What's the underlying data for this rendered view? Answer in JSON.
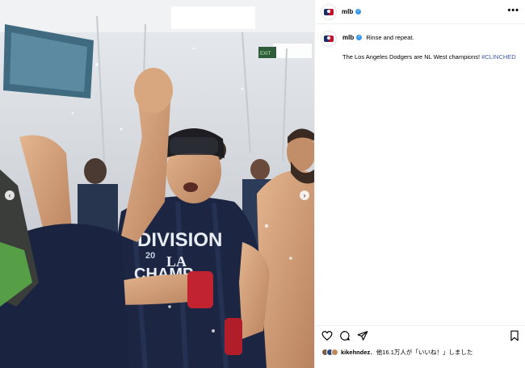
{
  "post": {
    "username": "mlb",
    "verified_mark": "✓",
    "more_glyph": "•••",
    "caption_lead": "Rinse and repeat.",
    "caption_body": "The Los Angeles Dodgers are NL West champions! ",
    "hashtag": "#CLINCHED"
  },
  "media": {
    "prev_glyph": "‹",
    "next_glyph": "›",
    "jersey_line1": "DIVISION",
    "jersey_line2": "20",
    "jersey_logo": "LA",
    "jersey_line3": "CHAMP",
    "exit_sign": "EXIT"
  },
  "likes": {
    "user": "kikehndez",
    "rest": "、他16.1万人が「いいね！」しました"
  },
  "icons": [
    "heart-icon",
    "comment-icon",
    "share-icon",
    "bookmark-icon",
    "mlb-logo-icon"
  ],
  "colors": {
    "verified": "#3897f0",
    "hashtag": "#3f5aa8",
    "navy": "#1a2d6b",
    "red": "#c8102e"
  }
}
